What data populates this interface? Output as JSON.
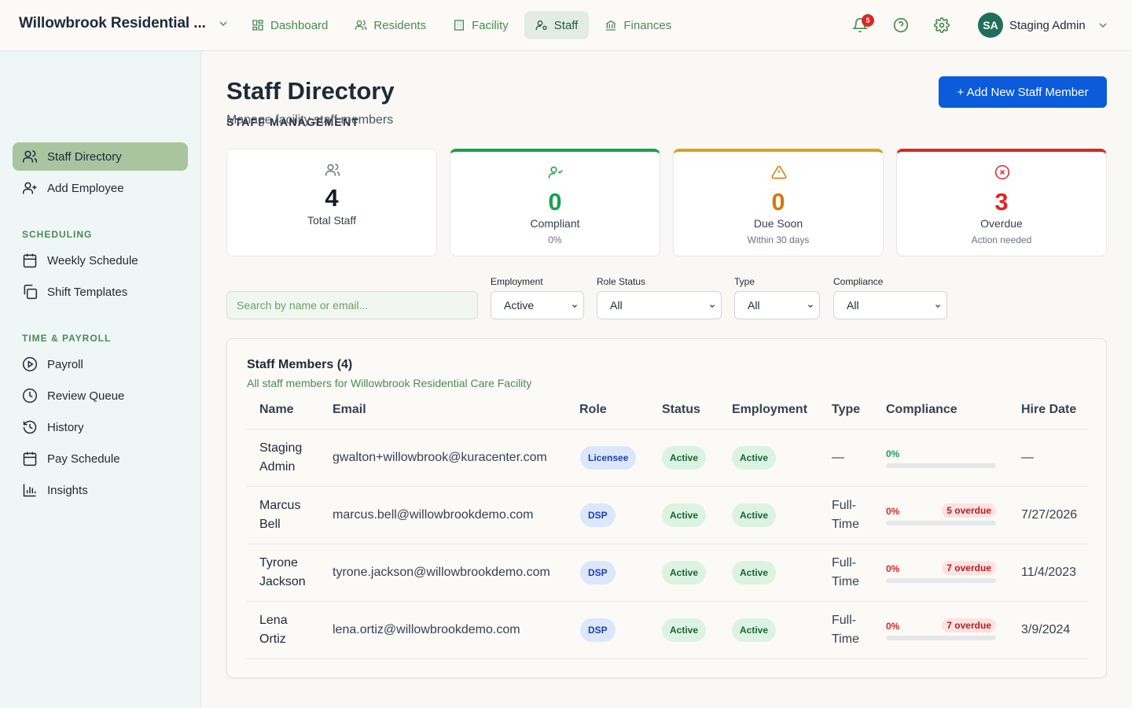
{
  "app": {
    "title": "Willowbrook Residential ..."
  },
  "nav": [
    {
      "label": "Dashboard",
      "icon": "layout-icon"
    },
    {
      "label": "Residents",
      "icon": "users-icon"
    },
    {
      "label": "Facility",
      "icon": "building-icon"
    },
    {
      "label": "Staff",
      "icon": "user-cog-icon",
      "active": true
    },
    {
      "label": "Finances",
      "icon": "bank-icon"
    }
  ],
  "notifications": {
    "count": "5"
  },
  "user": {
    "initials": "SA",
    "name": "Staging Admin"
  },
  "sidebar": {
    "heading": "STAFF MANAGEMENT",
    "primary": [
      {
        "label": "Staff Directory",
        "icon": "users-icon",
        "active": true
      },
      {
        "label": "Add Employee",
        "icon": "user-plus-icon"
      }
    ],
    "scheduling_heading": "SCHEDULING",
    "scheduling": [
      {
        "label": "Weekly Schedule",
        "icon": "calendar-icon"
      },
      {
        "label": "Shift Templates",
        "icon": "copy-icon"
      }
    ],
    "payroll_heading": "TIME & PAYROLL",
    "payroll": [
      {
        "label": "Payroll",
        "icon": "play-circle-icon"
      },
      {
        "label": "Review Queue",
        "icon": "clock-icon"
      },
      {
        "label": "History",
        "icon": "history-icon"
      },
      {
        "label": "Pay Schedule",
        "icon": "calendar-grid-icon"
      },
      {
        "label": "Insights",
        "icon": "bar-chart-icon"
      }
    ]
  },
  "page": {
    "title": "Staff Directory",
    "subtitle": "Manage facility staff members",
    "add_button": "+ Add New Staff Member"
  },
  "stats": [
    {
      "value": "4",
      "label": "Total Staff",
      "sub": "",
      "color": "#111827"
    },
    {
      "value": "0",
      "label": "Compliant",
      "sub": "0%",
      "color": "#16a34a"
    },
    {
      "value": "0",
      "label": "Due Soon",
      "sub": "Within 30 days",
      "color": "#d97706"
    },
    {
      "value": "3",
      "label": "Overdue",
      "sub": "Action needed",
      "color": "#dc2626"
    }
  ],
  "filters": {
    "search_placeholder": "Search by name or email...",
    "employment": {
      "label": "Employment",
      "value": "Active"
    },
    "role_status": {
      "label": "Role Status",
      "value": "All"
    },
    "type": {
      "label": "Type",
      "value": "All"
    },
    "compliance": {
      "label": "Compliance",
      "value": "All"
    }
  },
  "table": {
    "title": "Staff Members (4)",
    "subtitle": "All staff members for Willowbrook Residential Care Facility",
    "headers": [
      "Name",
      "Email",
      "Role",
      "Status",
      "Employment",
      "Type",
      "Compliance",
      "Hire Date"
    ],
    "rows": [
      {
        "first": "Staging",
        "last": "Admin",
        "email": "gwalton+willowbrook@kuracenter.com",
        "role": "Licensee",
        "status": "Active",
        "employment": "Active",
        "type_a": "—",
        "type_b": "",
        "pct": "0%",
        "pct_color": "#16a34a",
        "overdue": "",
        "hire": "—"
      },
      {
        "first": "Marcus",
        "last": "Bell",
        "email": "marcus.bell@willowbrookdemo.com",
        "role": "DSP",
        "status": "Active",
        "employment": "Active",
        "type_a": "Full-",
        "type_b": "Time",
        "pct": "0%",
        "pct_color": "#dc2626",
        "overdue": "5 overdue",
        "hire": "7/27/2026"
      },
      {
        "first": "Tyrone",
        "last": "Jackson",
        "email": "tyrone.jackson@willowbrookdemo.com",
        "role": "DSP",
        "status": "Active",
        "employment": "Active",
        "type_a": "Full-",
        "type_b": "Time",
        "pct": "0%",
        "pct_color": "#dc2626",
        "overdue": "7 overdue",
        "hire": "11/4/2023"
      },
      {
        "first": "Lena",
        "last": "Ortiz",
        "email": "lena.ortiz@willowbrookdemo.com",
        "role": "DSP",
        "status": "Active",
        "employment": "Active",
        "type_a": "Full-",
        "type_b": "Time",
        "pct": "0%",
        "pct_color": "#dc2626",
        "overdue": "7 overdue",
        "hire": "3/9/2024"
      }
    ]
  }
}
